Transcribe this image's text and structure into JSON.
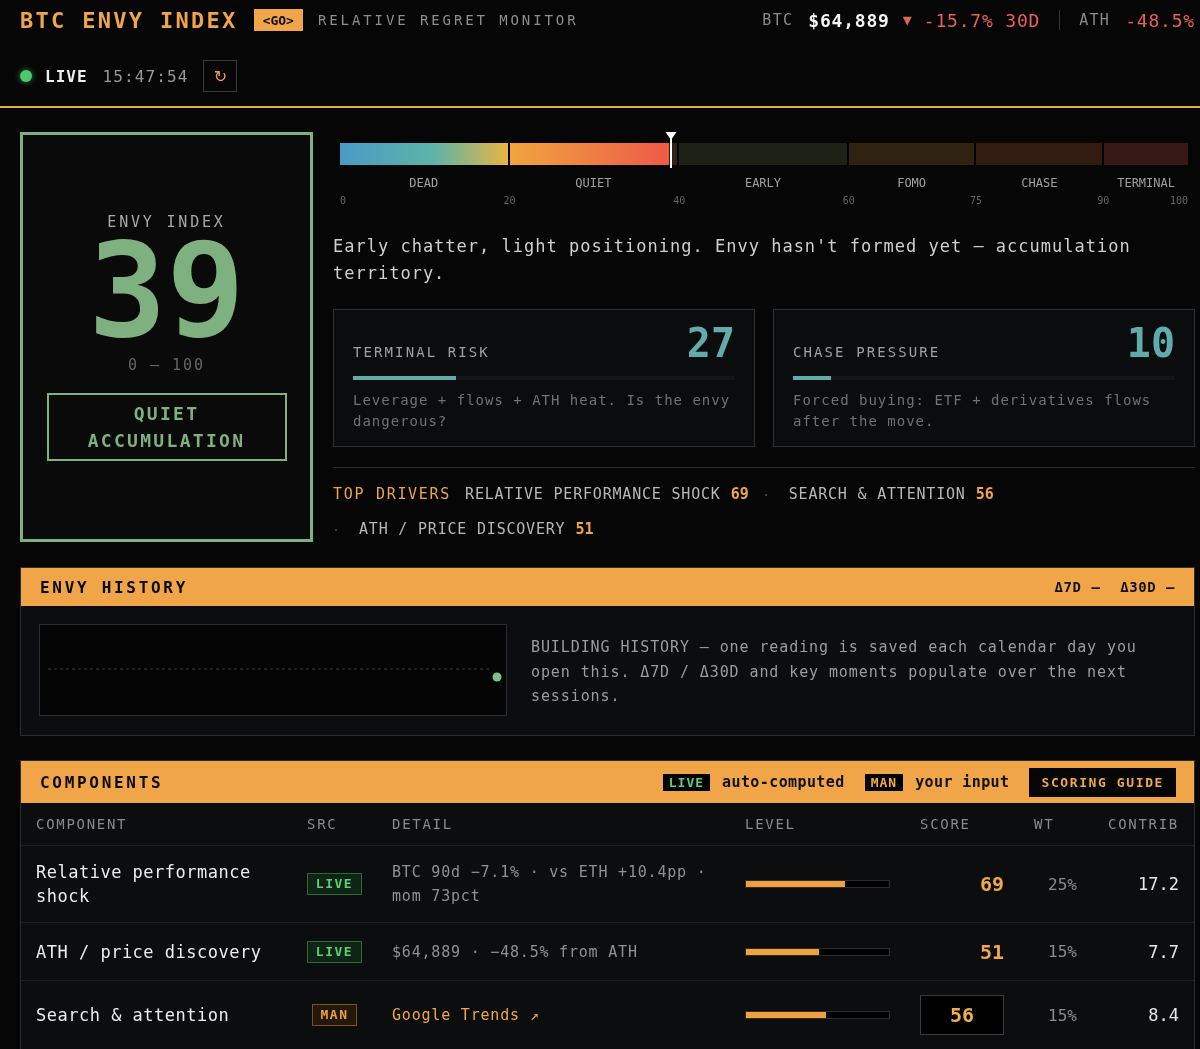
{
  "header": {
    "title": "BTC ENVY INDEX",
    "badge": "<GO>",
    "subtitle": "RELATIVE REGRET MONITOR",
    "ticker": {
      "symbol": "BTC",
      "price": "$64,889",
      "change_icon": "▼",
      "change": "-15.7% 30D",
      "ath_label": "ATH",
      "ath_change": "-48.5%"
    }
  },
  "status": {
    "live": true,
    "label": "LIVE",
    "time": "15:47:54",
    "refresh_icon": "↻"
  },
  "index_card": {
    "label": "ENVY INDEX",
    "value": "39",
    "range": "0 — 100",
    "regime": "QUIET ACCUMULATION"
  },
  "gauge": {
    "level": 0.39,
    "zones": [
      "DEAD",
      "QUIET",
      "EARLY",
      "FOMO",
      "CHASE",
      "TERMINAL"
    ],
    "ticks": [
      "0",
      "20",
      "40",
      "60",
      "75",
      "90",
      "100"
    ]
  },
  "summary": "Early chatter, light positioning. Envy hasn't formed yet — accumulation territory.",
  "risk_cards": [
    {
      "title": "TERMINAL RISK",
      "value": "27",
      "level": 0.27,
      "description": "Leverage + flows + ATH heat. Is the envy dangerous?"
    },
    {
      "title": "CHASE PRESSURE",
      "value": "10",
      "level": 0.1,
      "description": "Forced buying: ETF + derivatives flows after the move."
    }
  ],
  "top_drivers": {
    "label": "TOP DRIVERS",
    "items": [
      {
        "name": "RELATIVE PERFORMANCE SHOCK",
        "score": "69"
      },
      {
        "name": "SEARCH & ATTENTION",
        "score": "56"
      },
      {
        "name": "ATH / PRICE DISCOVERY",
        "score": "51"
      }
    ]
  },
  "history": {
    "title": "ENVY HISTORY",
    "deltas": [
      {
        "label": "Δ7D",
        "value": "—"
      },
      {
        "label": "Δ30D",
        "value": "—"
      }
    ],
    "note": "BUILDING HISTORY — one reading is saved each calendar day you open this. Δ7D / Δ30D and key moments populate over the next sessions."
  },
  "components": {
    "title": "COMPONENTS",
    "legend": [
      {
        "kind": "live",
        "badge": "LIVE",
        "text": "auto-computed"
      },
      {
        "kind": "man",
        "badge": "MAN",
        "text": "your input"
      }
    ],
    "guide_button": "SCORING GUIDE",
    "columns": [
      "COMPONENT",
      "SRC",
      "DETAIL",
      "LEVEL",
      "SCORE",
      "WT",
      "CONTRIB"
    ],
    "rows": [
      {
        "name": "Relative performance shock",
        "source": {
          "kind": "live",
          "label": "LIVE"
        },
        "detail": "BTC 90d −7.1% · vs ETH +10.4pp · mom 73pct",
        "level": 0.69,
        "score": "69",
        "weight": "25%",
        "contrib": "17.2"
      },
      {
        "name": "ATH / price discovery",
        "source": {
          "kind": "live",
          "label": "LIVE"
        },
        "detail": "$64,889 · −48.5% from ATH",
        "level": 0.51,
        "score": "51",
        "weight": "15%",
        "contrib": "7.7"
      },
      {
        "name": "Search & attention",
        "source": {
          "kind": "man",
          "label": "MAN"
        },
        "detail": "Google Trends ↗",
        "level": 0.56,
        "score": "56",
        "weight": "15%",
        "contrib": "8.4"
      }
    ]
  }
}
